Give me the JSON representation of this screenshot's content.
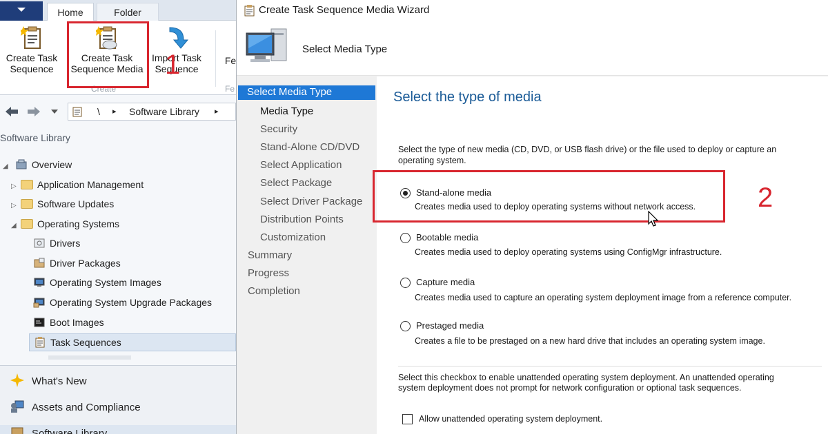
{
  "console": {
    "tabs": {
      "home": "Home",
      "folder": "Folder"
    },
    "ribbon": {
      "create_task_sequence": "Create Task\nSequence",
      "create_task_sequence_media": "Create Task\nSequence Media",
      "import_task_sequence": "Import Task\nSequence",
      "fe_partial": "Fe",
      "group_create": "Create",
      "group_fe": "Fe"
    },
    "callout_1": "1",
    "breadcrumb": {
      "sep": "\\",
      "arrow": "▸",
      "item": "Software Library",
      "arrow2": "▸"
    },
    "workspace_title": "Software Library",
    "tree": {
      "overview": "Overview",
      "application_management": "Application Management",
      "software_updates": "Software Updates",
      "operating_systems": "Operating Systems",
      "drivers": "Drivers",
      "driver_packages": "Driver Packages",
      "os_images": "Operating System Images",
      "os_upgrade_packages": "Operating System Upgrade Packages",
      "boot_images": "Boot Images",
      "task_sequences": "Task Sequences"
    },
    "wunderbar": {
      "whats_new": "What's New",
      "assets": "Assets and Compliance",
      "software_library": "Software Library"
    }
  },
  "wizard": {
    "title": "Create Task Sequence Media Wizard",
    "header_title": "Select Media Type",
    "steps": {
      "select_media_type": "Select Media Type",
      "media_type": "Media Type",
      "security": "Security",
      "standalone_cd": "Stand-Alone CD/DVD",
      "select_application": "Select Application",
      "select_package": "Select Package",
      "select_driver_package": "Select Driver Package",
      "distribution_points": "Distribution Points",
      "customization": "Customization",
      "summary": "Summary",
      "progress": "Progress",
      "completion": "Completion"
    },
    "content": {
      "title": "Select the type of media",
      "intro_line1": "Select the type of new media (CD, DVD, or USB flash drive) or the file used to deploy or capture an",
      "intro_line2": "operating system.",
      "options": {
        "standalone": {
          "label": "Stand-alone media",
          "desc": "Creates media used to deploy operating systems without network access.",
          "checked": true
        },
        "bootable": {
          "label": "Bootable media",
          "desc": "Creates media used to deploy operating systems using ConfigMgr infrastructure.",
          "checked": false
        },
        "capture": {
          "label": "Capture media",
          "desc": "Creates media used to capture an operating system deployment image from a reference computer.",
          "checked": false
        },
        "prestaged": {
          "label": "Prestaged media",
          "desc": "Creates a file to be prestaged on a new hard drive that includes an operating system image.",
          "checked": false
        }
      },
      "callout_2": "2",
      "unattended_line1": "Select this checkbox to enable unattended operating system deployment. An unattended operating",
      "unattended_line2": "system deployment does not prompt for network configuration or optional task sequences.",
      "unattended_checkbox": "Allow unattended operating system deployment.",
      "unattended_checked": false
    }
  },
  "colors": {
    "accent": "#1e78d6",
    "callout": "#d8262f",
    "title_blue": "#1b5b97"
  }
}
